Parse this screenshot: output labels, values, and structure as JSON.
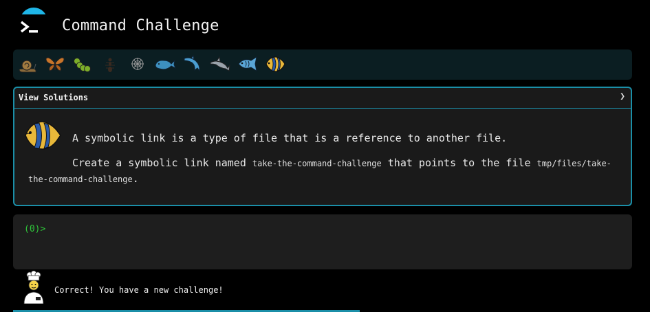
{
  "app": {
    "title": "Command Challenge",
    "logo_icon": "terminal-prompt-icon",
    "accent_color": "#1b8fa8",
    "logo_color": "#1fb6e8"
  },
  "levels": [
    {
      "icon": "snail-icon",
      "done": true
    },
    {
      "icon": "butterfly-icon",
      "done": true
    },
    {
      "icon": "caterpillar-icon",
      "done": true
    },
    {
      "icon": "ant-icon",
      "done": true
    },
    {
      "icon": "spider-web-icon",
      "done": true
    },
    {
      "icon": "whale-icon",
      "done": true
    },
    {
      "icon": "dolphin-icon",
      "done": true
    },
    {
      "icon": "shark-icon",
      "done": true
    },
    {
      "icon": "fish-icon",
      "done": true
    },
    {
      "icon": "tropical-fish-icon",
      "current": true
    }
  ],
  "solutions": {
    "label": "View Solutions",
    "chevron": "❯"
  },
  "challenge": {
    "icon": "tropical-fish-icon",
    "line1": "A symbolic link is a type of file that is a reference to another file.",
    "line2_pre": "Create a symbolic link named ",
    "line2_code1": "take-the-command-challenge",
    "line2_mid": " that points to the file ",
    "line2_code2": "tmp/files/take-the-command-challenge",
    "line2_end": "."
  },
  "terminal": {
    "prompt_open": "(",
    "prompt_count": "0",
    "prompt_close": ")>",
    "prompt_color": "#2fc63a"
  },
  "status": {
    "avatar_icon": "chef-icon",
    "message": "Correct! You have a new challenge!",
    "progress": 0.56
  }
}
